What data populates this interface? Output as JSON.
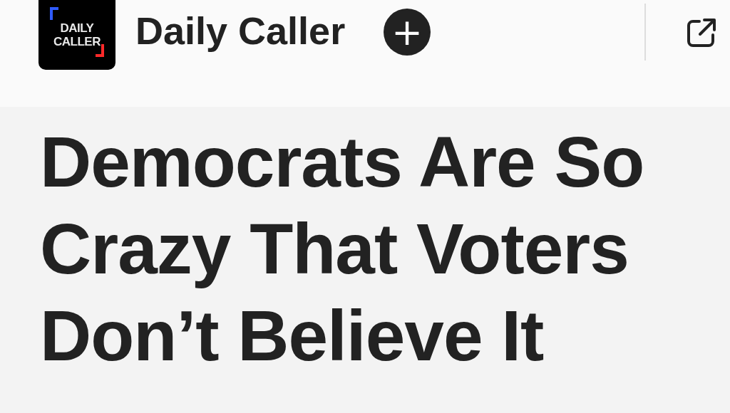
{
  "header": {
    "logo_text": [
      "DAILY",
      "CALLER"
    ],
    "publisher": "Daily Caller",
    "follow_button": "+"
  },
  "article": {
    "headline": "Democrats Are So Crazy That Voters Don’t Believe It"
  }
}
